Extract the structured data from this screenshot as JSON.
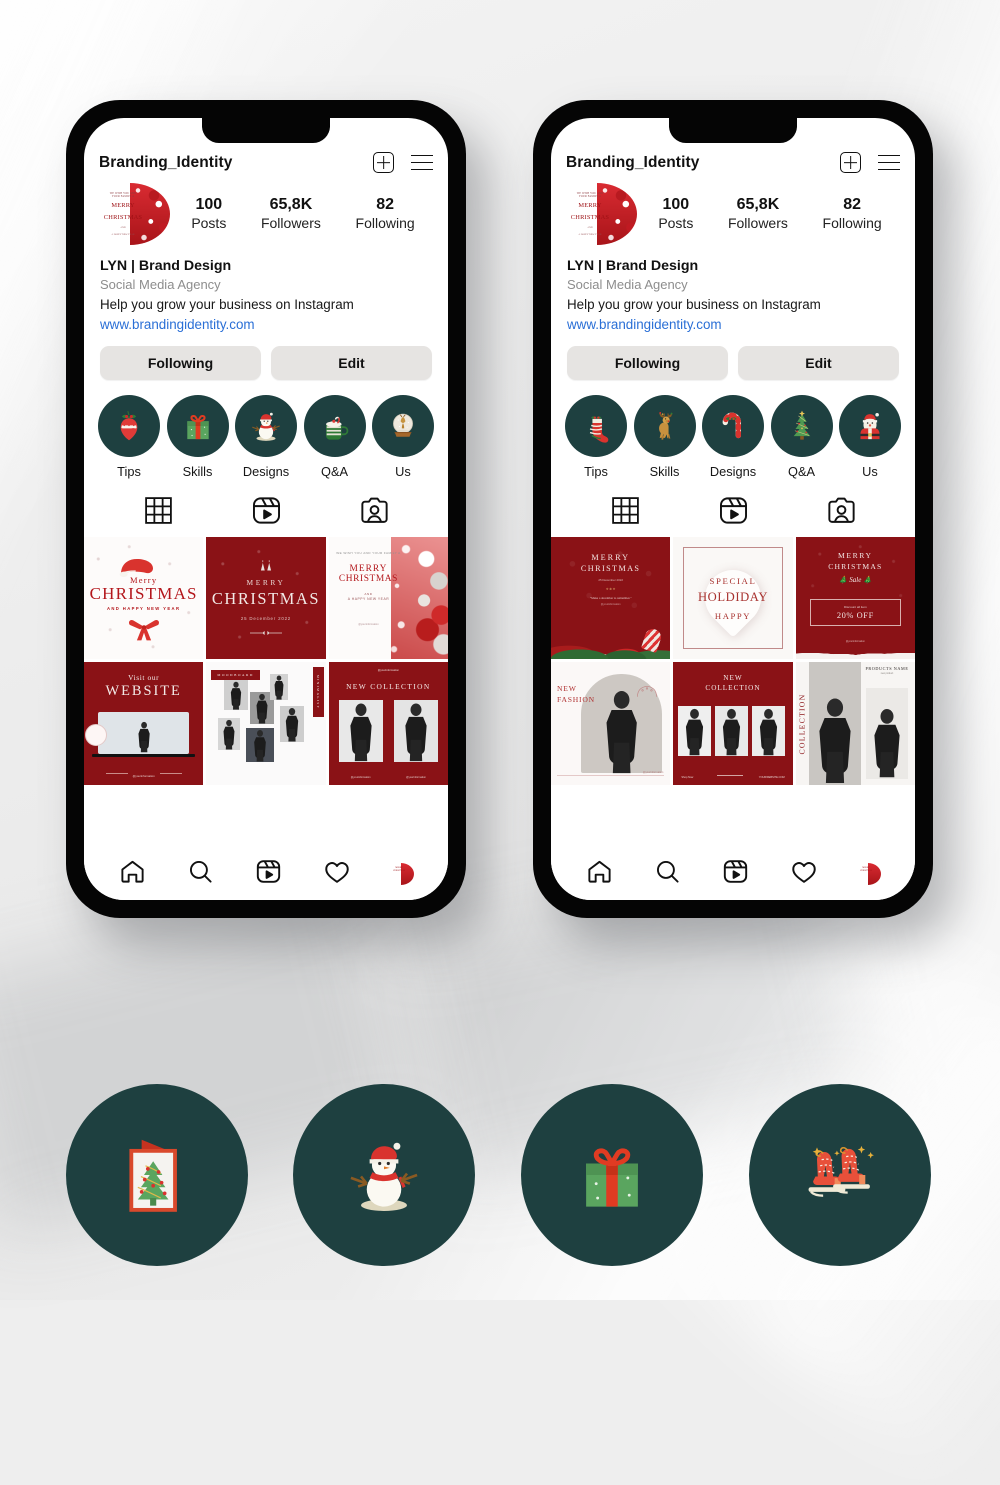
{
  "theme": {
    "accent_green": "#1e4040",
    "accent_red": "#8a1216",
    "link_blue": "#2a6fd6",
    "background": "#eeeeee"
  },
  "phones": [
    {
      "id": "phone-left",
      "header": {
        "username": "Branding_Identity",
        "add_icon": "plus-box-icon",
        "menu_icon": "hamburger-menu-icon"
      },
      "avatar": {
        "name": "profile-avatar",
        "line1": "WE WISH YOU AND",
        "line2": "YOUR FAMILY A",
        "title": "MERRY",
        "title2": "CHRISTMAS",
        "sub": "AND",
        "sub2": "A HAPPY NEW YEAR"
      },
      "stats": [
        {
          "number": "100",
          "label": "Posts"
        },
        {
          "number": "65,8K",
          "label": "Followers"
        },
        {
          "number": "82",
          "label": "Following"
        }
      ],
      "bio": {
        "name": "LYN | Brand Design",
        "category": "Social Media Agency",
        "description": "Help you grow your business on Instagram",
        "website": "www.brandingidentity.com"
      },
      "buttons": [
        {
          "label": "Following",
          "name": "following-button"
        },
        {
          "label": "Edit",
          "name": "edit-button"
        }
      ],
      "highlights": [
        {
          "label": "Tips",
          "icon": "christmas-ornament-icon"
        },
        {
          "label": "Skills",
          "icon": "gift-box-icon"
        },
        {
          "label": "Designs",
          "icon": "snowman-icon"
        },
        {
          "label": "Q&A",
          "icon": "hot-cocoa-mug-icon"
        },
        {
          "label": "Us",
          "icon": "snow-globe-icon"
        }
      ],
      "tabs": [
        {
          "icon": "grid-tab-icon",
          "active": true
        },
        {
          "icon": "reels-tab-icon",
          "active": false
        },
        {
          "icon": "tagged-tab-icon",
          "active": false
        }
      ],
      "posts": [
        {
          "id": "post-merry-christmas-bow",
          "style": "white-bow",
          "l1": "Merry",
          "l2": "CHRISTMAS",
          "l3": "AND HAPPY NEW YEAR"
        },
        {
          "id": "post-merry-christmas-dark",
          "style": "red-date",
          "l1": "MERRY",
          "l2": "CHRISTMAS",
          "l3": "25 December 2022"
        },
        {
          "id": "post-merry-christmas-baubles",
          "style": "white-baubles",
          "l0": "WE WISH YOU AND YOUR FAMILY A",
          "l1": "MERRY",
          "l2": "CHRISTMAS",
          "l3": "AND",
          "l4": "A HAPPY NEW YEAR",
          "handle": "@yourinformation"
        },
        {
          "id": "post-visit-our-website",
          "style": "website",
          "l1": "Visit our",
          "l2": "WEBSITE",
          "handle": "@yourinformation"
        },
        {
          "id": "post-moodboard",
          "style": "moodboard",
          "l1": "MOODBOARD",
          "l2": "MINIMALIST"
        },
        {
          "id": "post-new-collection",
          "style": "newcollection",
          "handle": "@yourinformation",
          "l1": "NEW COLLECTION",
          "h1": "@yourinformation",
          "h2": "@yourinformation"
        }
      ],
      "nav": [
        {
          "icon": "home-icon"
        },
        {
          "icon": "search-icon"
        },
        {
          "icon": "reels-icon"
        },
        {
          "icon": "heart-icon"
        },
        {
          "icon": "profile-avatar-icon"
        }
      ]
    },
    {
      "id": "phone-right",
      "header": {
        "username": "Branding_Identity",
        "add_icon": "plus-box-icon",
        "menu_icon": "hamburger-menu-icon"
      },
      "avatar": {
        "name": "profile-avatar",
        "line1": "WE WISH YOU AND",
        "line2": "YOUR FAMILY A",
        "title": "MERRY",
        "title2": "CHRISTMAS",
        "sub": "AND",
        "sub2": "A HAPPY NEW YEAR"
      },
      "stats": [
        {
          "number": "100",
          "label": "Posts"
        },
        {
          "number": "65,8K",
          "label": "Followers"
        },
        {
          "number": "82",
          "label": "Following"
        }
      ],
      "bio": {
        "name": "LYN | Brand Design",
        "category": "Social Media Agency",
        "description": "Help you grow your business on Instagram",
        "website": "www.brandingidentity.com"
      },
      "buttons": [
        {
          "label": "Following",
          "name": "following-button"
        },
        {
          "label": "Edit",
          "name": "edit-button"
        }
      ],
      "highlights": [
        {
          "label": "Tips",
          "icon": "christmas-stocking-icon"
        },
        {
          "label": "Skills",
          "icon": "reindeer-icon"
        },
        {
          "label": "Designs",
          "icon": "candy-cane-icon"
        },
        {
          "label": "Q&A",
          "icon": "christmas-tree-icon"
        },
        {
          "label": "Us",
          "icon": "santa-claus-icon"
        }
      ],
      "tabs": [
        {
          "icon": "grid-tab-icon",
          "active": true
        },
        {
          "icon": "reels-tab-icon",
          "active": false
        },
        {
          "icon": "tagged-tab-icon",
          "active": false
        }
      ],
      "posts": [
        {
          "id": "post-merry-christmas-wreath",
          "style": "red-wreath",
          "l1": "MERRY",
          "l2": "CHRISTMAS",
          "l3": "25 December 2022",
          "l4": "\"Make a december to remember.\"",
          "handle": "@yourinformation"
        },
        {
          "id": "post-special-holiday",
          "style": "special",
          "l1": "SPECIAL",
          "l2": "HOLDIDAY",
          "l3": "HAPPY"
        },
        {
          "id": "post-christmas-sale",
          "style": "sale",
          "l1": "MERRY",
          "l2": "CHRISTMAS",
          "l3": "Sale",
          "l4": "Discount all item",
          "l5": "20% OFF",
          "handle": "@yourinformation"
        },
        {
          "id": "post-new-fashion",
          "style": "newfashion",
          "l1": "NEW",
          "l2": "FASHION",
          "handle": "@yourinformation"
        },
        {
          "id": "post-new-collection-grid",
          "style": "newcollection-grid",
          "l1": "NEW",
          "l2": "COLLECTION",
          "l3": "Shop Now",
          "l4": "YOURWEBSITE.COM"
        },
        {
          "id": "post-collection-products",
          "style": "collection-products",
          "l1": "COLLECTION",
          "l2": "PRODUCTS NAME",
          "l3": "new product"
        }
      ],
      "nav": [
        {
          "icon": "home-icon"
        },
        {
          "icon": "search-icon"
        },
        {
          "icon": "reels-icon"
        },
        {
          "icon": "heart-icon"
        },
        {
          "icon": "profile-avatar-icon"
        }
      ]
    }
  ],
  "showcase_circles": [
    {
      "icon": "christmas-card-icon",
      "name": "showcase-christmas-card"
    },
    {
      "icon": "snowman-icon",
      "name": "showcase-snowman"
    },
    {
      "icon": "gift-box-icon",
      "name": "showcase-gift-box"
    },
    {
      "icon": "ice-skates-icon",
      "name": "showcase-ice-skates"
    }
  ]
}
